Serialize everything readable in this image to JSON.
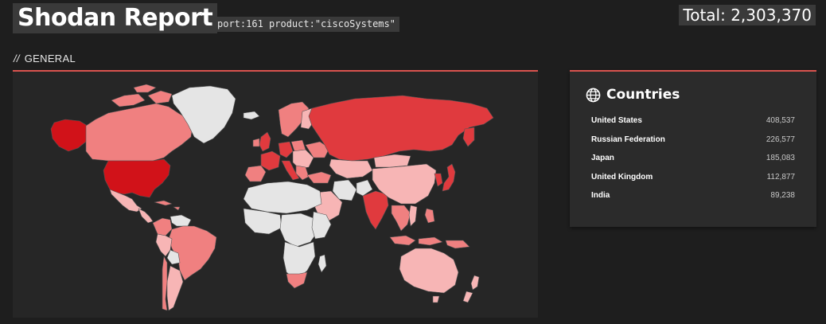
{
  "header": {
    "title": "Shodan Report",
    "query": "port:161 product:\"ciscoSystems\"",
    "total": "Total: 2,303,370"
  },
  "section": {
    "slashes": "//",
    "label": "GENERAL"
  },
  "countries": {
    "title": "Countries",
    "icon": "globe-icon",
    "items": [
      {
        "name": "United States",
        "count": "408,537"
      },
      {
        "name": "Russian Federation",
        "count": "226,577"
      },
      {
        "name": "Japan",
        "count": "185,083"
      },
      {
        "name": "United Kingdom",
        "count": "112,877"
      },
      {
        "name": "India",
        "count": "89,238"
      }
    ]
  },
  "colors": {
    "background": "#1e1e1e",
    "panel": "#262626",
    "accent": "#d9534f",
    "heat_high": "#d11219",
    "heat_mid": "#e03a3e",
    "heat_low": "#f08080",
    "heat_lowest": "#f7b5b5",
    "no_data": "#e5e5e5"
  }
}
